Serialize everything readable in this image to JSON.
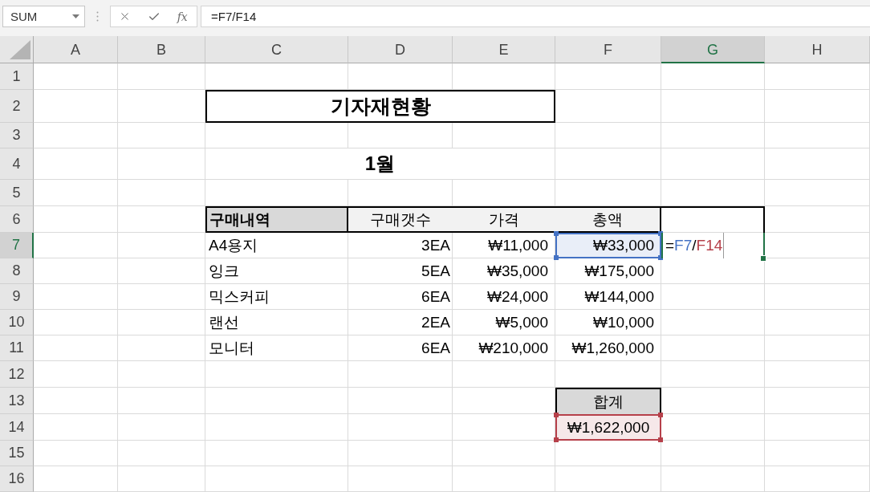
{
  "formula_bar": {
    "name_box": "SUM",
    "function_button": "fx",
    "formula": "=F7/F14"
  },
  "column_headers": [
    {
      "label": "A",
      "selected": false
    },
    {
      "label": "B",
      "selected": false
    },
    {
      "label": "C",
      "selected": false
    },
    {
      "label": "D",
      "selected": false
    },
    {
      "label": "E",
      "selected": false
    },
    {
      "label": "F",
      "selected": false
    },
    {
      "label": "G",
      "selected": true
    },
    {
      "label": "H",
      "selected": false
    }
  ],
  "row_headers": [
    {
      "label": "1",
      "selected": false
    },
    {
      "label": "2",
      "selected": false
    },
    {
      "label": "3",
      "selected": false
    },
    {
      "label": "4",
      "selected": false
    },
    {
      "label": "5",
      "selected": false
    },
    {
      "label": "6",
      "selected": false
    },
    {
      "label": "7",
      "selected": true
    },
    {
      "label": "8",
      "selected": false
    },
    {
      "label": "9",
      "selected": false
    },
    {
      "label": "10",
      "selected": false
    },
    {
      "label": "11",
      "selected": false
    },
    {
      "label": "12",
      "selected": false
    },
    {
      "label": "13",
      "selected": false
    },
    {
      "label": "14",
      "selected": false
    },
    {
      "label": "15",
      "selected": false
    },
    {
      "label": "16",
      "selected": false
    }
  ],
  "title": "기자재현황",
  "subtitle": "1월",
  "purchase_table": {
    "columns": [
      "구매내역",
      "구매갯수",
      "가격",
      "총액"
    ],
    "rows": [
      {
        "item": "A4용지",
        "count": "3EA",
        "price": "₩11,000",
        "total": "₩33,000",
        "color": "#4472c4"
      },
      {
        "item": "잉크",
        "count": "5EA",
        "price": "₩35,000",
        "total": "₩175,000"
      },
      {
        "item": "믹스커피",
        "count": "6EA",
        "price": "₩24,000",
        "total": "₩144,000"
      },
      {
        "item": "랜선",
        "count": "2EA",
        "price": "₩5,000",
        "total": "₩10,000"
      },
      {
        "item": "모니터",
        "count": "6EA",
        "price": "₩210,000",
        "total": "₩1,260,000"
      }
    ]
  },
  "editing_cell": {
    "tokens": [
      {
        "text": "=",
        "kind": "operator"
      },
      {
        "text": "F7",
        "kind": "reference",
        "color": "#4472c4"
      },
      {
        "text": "/",
        "kind": "operator"
      },
      {
        "text": "F14",
        "kind": "reference",
        "color": "#b6404a"
      }
    ]
  },
  "summary": {
    "label": "합계",
    "value": "₩1,622,000",
    "color": "#b6404a"
  }
}
